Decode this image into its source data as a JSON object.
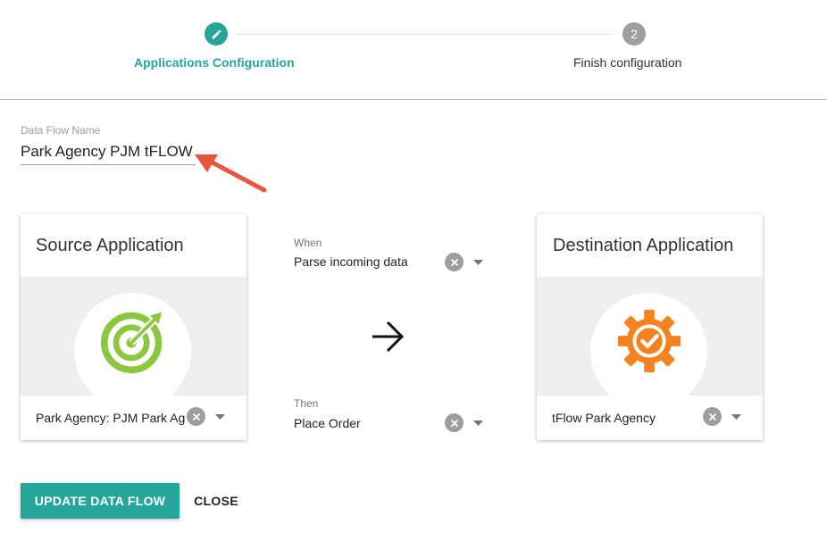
{
  "stepper": {
    "steps": [
      {
        "label": "Applications Configuration",
        "icon": "pencil-icon",
        "state": "active"
      },
      {
        "label": "Finish configuration",
        "number": "2",
        "state": "pending"
      }
    ]
  },
  "name_field": {
    "label": "Data Flow Name",
    "value": "Park Agency PJM tFLOW"
  },
  "source_card": {
    "title": "Source Application",
    "icon": "target-icon",
    "selected": "Park Agency: PJM Park Agency"
  },
  "middle": {
    "when_label": "When",
    "when_value": "Parse incoming data",
    "then_label": "Then",
    "then_value": "Place Order",
    "arrow_icon": "arrow-right-icon"
  },
  "destination_card": {
    "title": "Destination Application",
    "icon": "gear-check-icon",
    "selected": "tFlow Park Agency"
  },
  "actions": {
    "primary": "UPDATE DATA FLOW",
    "secondary": "CLOSE"
  },
  "colors": {
    "accent": "#26a69a",
    "target_green": "#8dc63f",
    "gear_orange": "#f58220",
    "annotation_red": "#e8553e"
  }
}
